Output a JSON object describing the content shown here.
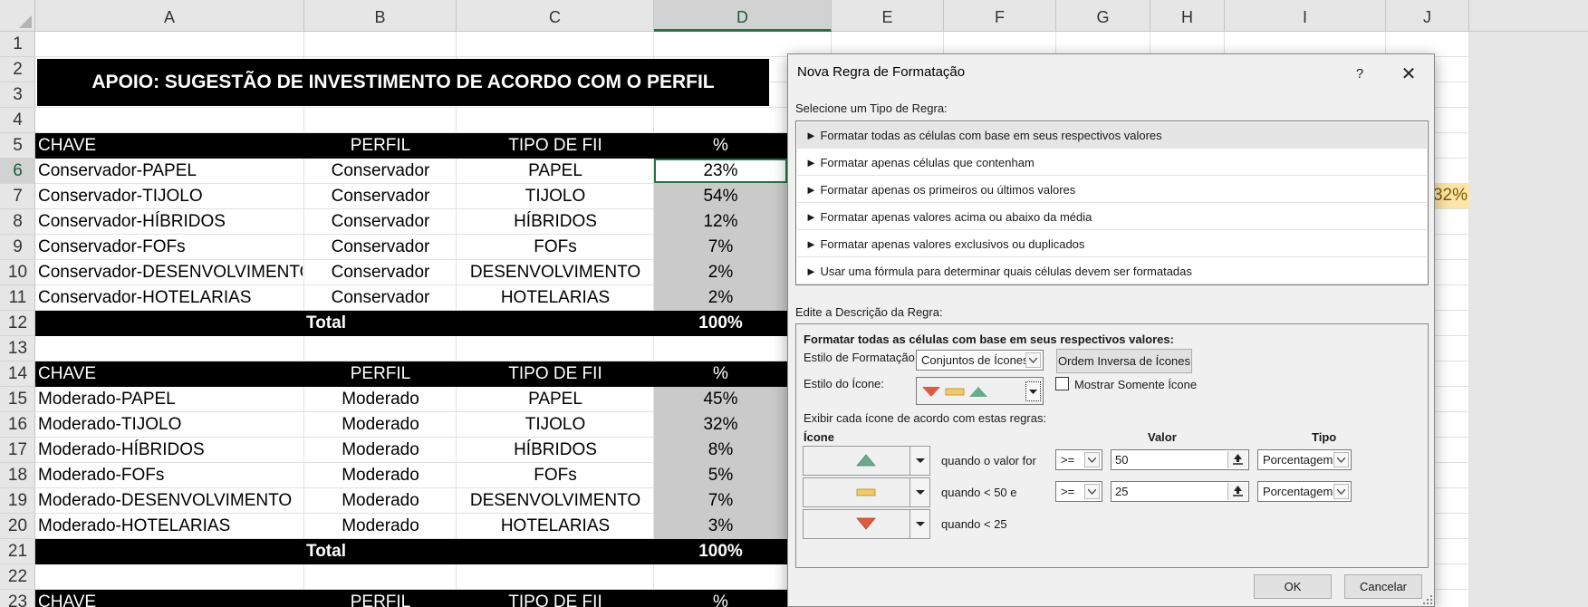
{
  "columns": [
    "A",
    "B",
    "C",
    "D",
    "E",
    "F",
    "G",
    "H",
    "I",
    "J"
  ],
  "rows": [
    "1",
    "2",
    "3",
    "4",
    "5",
    "6",
    "7",
    "8",
    "9",
    "10",
    "11",
    "12",
    "13",
    "14",
    "15",
    "16",
    "17",
    "18",
    "19",
    "20",
    "21",
    "22",
    "23"
  ],
  "sheet": {
    "banner": "APOIO: SUGESTÃO DE INVESTIMENTO DE ACORDO COM O PERFIL",
    "headers": [
      "CHAVE",
      "PERFIL",
      "TIPO DE FII",
      "%"
    ],
    "total_label": "Total",
    "conservador": [
      {
        "chave": "Conservador-PAPEL",
        "perfil": "Conservador",
        "tipo": "PAPEL",
        "pct": "23%"
      },
      {
        "chave": "Conservador-TIJOLO",
        "perfil": "Conservador",
        "tipo": "TIJOLO",
        "pct": "54%"
      },
      {
        "chave": "Conservador-HÍBRIDOS",
        "perfil": "Conservador",
        "tipo": "HÍBRIDOS",
        "pct": "12%"
      },
      {
        "chave": "Conservador-FOFs",
        "perfil": "Conservador",
        "tipo": "FOFs",
        "pct": "7%"
      },
      {
        "chave": "Conservador-DESENVOLVIMENTO",
        "perfil": "Conservador",
        "tipo": "DESENVOLVIMENTO",
        "pct": "2%"
      },
      {
        "chave": "Conservador-HOTELARIAS",
        "perfil": "Conservador",
        "tipo": "HOTELARIAS",
        "pct": "2%"
      }
    ],
    "conservador_total": "100%",
    "moderado": [
      {
        "chave": "Moderado-PAPEL",
        "perfil": "Moderado",
        "tipo": "PAPEL",
        "pct": "45%"
      },
      {
        "chave": "Moderado-TIJOLO",
        "perfil": "Moderado",
        "tipo": "TIJOLO",
        "pct": "32%"
      },
      {
        "chave": "Moderado-HÍBRIDOS",
        "perfil": "Moderado",
        "tipo": "HÍBRIDOS",
        "pct": "8%"
      },
      {
        "chave": "Moderado-FOFs",
        "perfil": "Moderado",
        "tipo": "FOFs",
        "pct": "5%"
      },
      {
        "chave": "Moderado-DESENVOLVIMENTO",
        "perfil": "Moderado",
        "tipo": "DESENVOLVIMENTO",
        "pct": "7%"
      },
      {
        "chave": "Moderado-HOTELARIAS",
        "perfil": "Moderado",
        "tipo": "HOTELARIAS",
        "pct": "3%"
      }
    ],
    "moderado_total": "100%",
    "outside_value": "32%"
  },
  "dialog": {
    "title": "Nova Regra de Formatação",
    "help": "?",
    "close": "✕",
    "select_type_label": "Selecione um Tipo de Regra:",
    "rule_types": [
      "► Formatar todas as células com base em seus respectivos valores",
      "► Formatar apenas células que contenham",
      "► Formatar apenas os primeiros ou últimos valores",
      "► Formatar apenas valores acima ou abaixo da média",
      "► Formatar apenas valores exclusivos ou duplicados",
      "► Usar uma fórmula para determinar quais células devem ser formatadas"
    ],
    "edit_desc_label": "Edite a Descrição da Regra:",
    "desc_heading": "Formatar todas as células com base em seus respectivos valores:",
    "format_style_label": "Estilo de Formatação:",
    "format_style_value": "Conjuntos de Ícones",
    "reverse_button": "Ordem Inversa de Ícones",
    "icon_style_label": "Estilo do Ícone:",
    "show_icon_only": "Mostrar Somente Ícone",
    "show_icon_only_checked": false,
    "rules_intro": "Exibir cada ícone de acordo com estas regras:",
    "col_icon": "Ícone",
    "col_value": "Valor",
    "col_type": "Tipo",
    "rules": [
      {
        "icon": "green-up-triangle-icon",
        "text": "quando o valor for",
        "op": ">=",
        "value": "50",
        "type": "Porcentagem"
      },
      {
        "icon": "yellow-bar-icon",
        "text": "quando < 50 e",
        "op": ">=",
        "value": "25",
        "type": "Porcentagem"
      },
      {
        "icon": "red-down-triangle-icon",
        "text": "quando < 25"
      }
    ],
    "ok": "OK",
    "cancel": "Cancelar",
    "colors": {
      "green": "#6aaa8c",
      "yellow": "#f3c868",
      "red": "#dd5c3f"
    }
  }
}
